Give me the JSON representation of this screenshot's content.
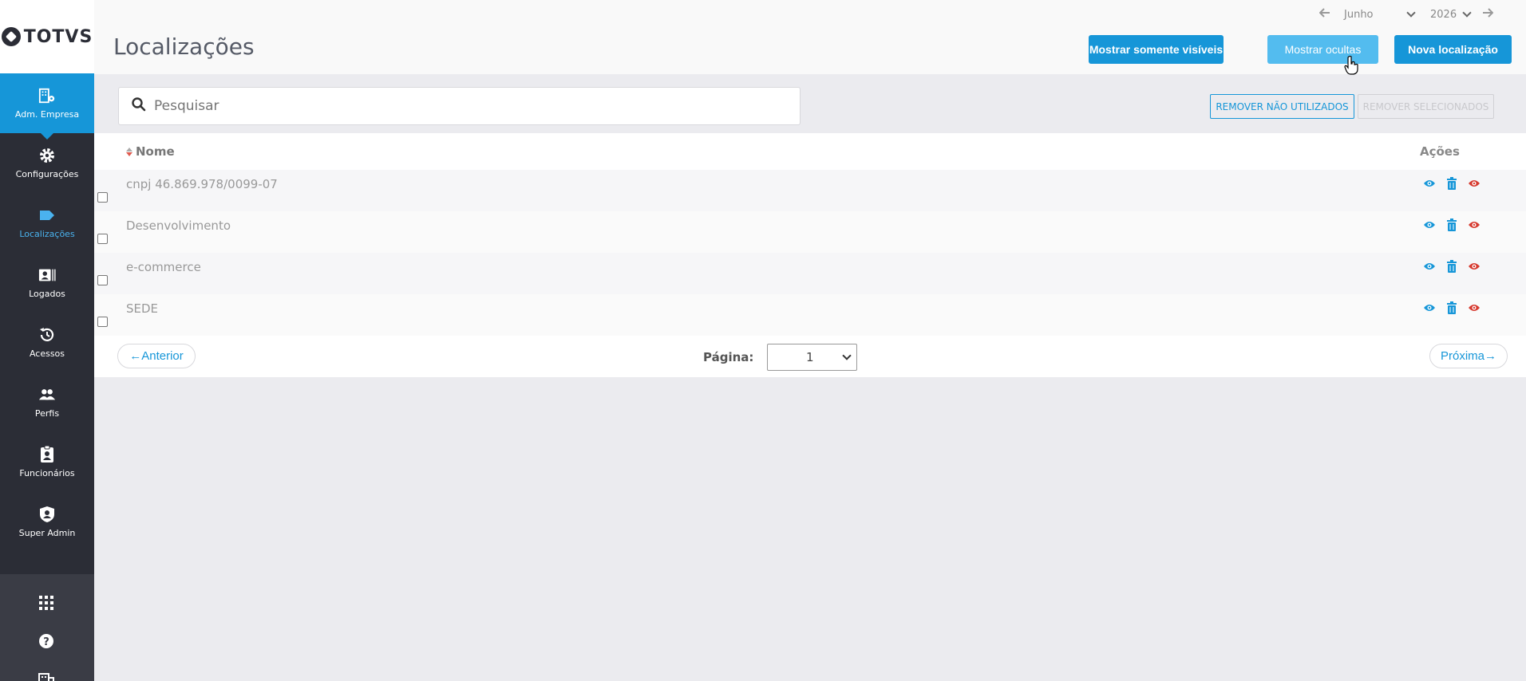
{
  "brand": {
    "logo_text": "TOTVS"
  },
  "sidebar": {
    "items": [
      {
        "label": "Adm. Empresa",
        "icon": "building-gear-icon"
      },
      {
        "label": "Configurações",
        "icon": "gear-icon"
      },
      {
        "label": "Localizações",
        "icon": "tag-icon"
      },
      {
        "label": "Logados",
        "icon": "id-card-icon"
      },
      {
        "label": "Acessos",
        "icon": "history-icon"
      },
      {
        "label": "Perfis",
        "icon": "users-icon"
      },
      {
        "label": "Funcionários",
        "icon": "badge-icon"
      },
      {
        "label": "Super Admin",
        "icon": "shield-user-icon"
      }
    ],
    "bottom_icons": [
      "apps-grid-icon",
      "help-icon",
      "building-icon"
    ]
  },
  "header": {
    "title": "Localizações",
    "month": "Junho",
    "year": "2026",
    "buttons": {
      "show_visible": "Mostrar somente visíveis",
      "show_hidden": "Mostrar ocultas",
      "new_location": "Nova localização"
    }
  },
  "toolbar": {
    "search_placeholder": "Pesquisar",
    "remove_unused": "REMOVER NÃO UTILIZADOS",
    "remove_selected": "REMOVER SELECIONADOS"
  },
  "table": {
    "columns": {
      "name": "Nome",
      "actions": "Ações"
    },
    "rows": [
      {
        "name": "cnpj 46.869.978/0099-07"
      },
      {
        "name": "Desenvolvimento"
      },
      {
        "name": "e-commerce"
      },
      {
        "name": "SEDE"
      }
    ]
  },
  "pagination": {
    "prev": "←Anterior",
    "next": "Próxima→",
    "page_label": "Página:",
    "current_page": "1"
  },
  "colors": {
    "primary": "#1696d8",
    "primary_light": "#53bcef",
    "sidebar_bg": "#2b2d36",
    "danger": "#d63a2f"
  }
}
